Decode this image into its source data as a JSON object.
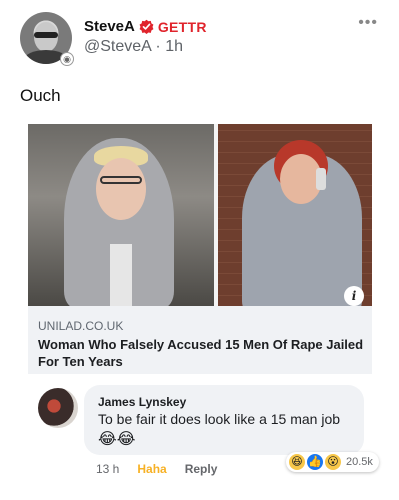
{
  "post": {
    "author_name": "SteveA",
    "platform": "GETTR",
    "handle": "@SteveA",
    "separator": "·",
    "time_ago": "1h",
    "more_icon": "•••",
    "text": "Ouch"
  },
  "link_card": {
    "info_icon": "i",
    "domain": "UNILAD.CO.UK",
    "headline": "Woman Who Falsely Accused 15 Men Of Rape Jailed For Ten Years"
  },
  "comment": {
    "author": "James Lynskey",
    "text": "To be fair it does look like a 15 man job",
    "emoji": "😂😂",
    "time": "13 h",
    "reaction_label": "Haha",
    "reply_label": "Reply",
    "reactions": {
      "icons": [
        "😆",
        "👍",
        "😮"
      ],
      "count": "20.5k"
    }
  },
  "colors": {
    "gettr_red": "#e0242c",
    "haha_yellow": "#f7b125",
    "like_blue": "#1877f2"
  }
}
